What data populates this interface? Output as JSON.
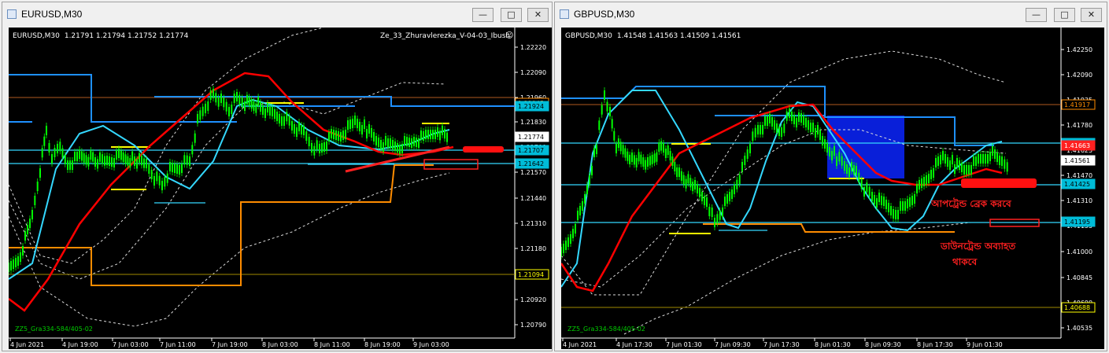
{
  "windows": [
    {
      "title": "EURUSD,M30",
      "chart_title": "EURUSD,M30",
      "ohlc": "1.21791 1.21794 1.21752 1.21774",
      "indicator_name": "Ze_33_Zhuravlerezka_V-04-03_Ibush",
      "watermark": "ZZ5_Gra334-584/405-02",
      "price_ticks": [
        "1.22220",
        "1.22090",
        "1.21960",
        "1.21830",
        "1.21700",
        "1.21570",
        "1.21440",
        "1.21310",
        "1.21180",
        "1.21050",
        "1.20920",
        "1.20790"
      ],
      "time_ticks": [
        "4 Jun 2021",
        "4 Jun 19:00",
        "7 Jun 03:00",
        "7 Jun 11:00",
        "7 Jun 19:00",
        "8 Jun 03:00",
        "8 Jun 11:00",
        "8 Jun 19:00",
        "9 Jun 03:00"
      ],
      "price_labels": [
        {
          "text": "1.21945",
          "style": "orange"
        },
        {
          "text": "1.21924",
          "style": "cyan"
        },
        {
          "text": "1.21774",
          "style": "white"
        },
        {
          "text": "1.21707",
          "style": "cyan"
        },
        {
          "text": "1.21642",
          "style": "cyan"
        },
        {
          "text": "1.21094",
          "style": "yellow"
        }
      ],
      "annotations": []
    },
    {
      "title": "GBPUSD,M30",
      "chart_title": "GBPUSD,M30",
      "ohlc": "1.41548 1.41563 1.41509 1.41561",
      "indicator_name": "",
      "watermark": "ZZ5_Gra334-584/405-02",
      "price_ticks": [
        "1.42250",
        "1.42090",
        "1.41935",
        "1.41780",
        "1.41625",
        "1.41470",
        "1.41310",
        "1.41155",
        "1.41000",
        "1.40845",
        "1.40690",
        "1.40535"
      ],
      "time_ticks": [
        "4 Jun 2021",
        "4 Jun 17:30",
        "7 Jun 01:30",
        "7 Jun 09:30",
        "7 Jun 17:30",
        "8 Jun 01:30",
        "8 Jun 09:30",
        "8 Jun 17:30",
        "9 Jun 01:30"
      ],
      "price_labels": [
        {
          "text": "1.41917",
          "style": "orange"
        },
        {
          "text": "1.41669",
          "style": "cyan"
        },
        {
          "text": "1.41663",
          "style": "red"
        },
        {
          "text": "1.41561",
          "style": "white"
        },
        {
          "text": "1.41425",
          "style": "cyan"
        },
        {
          "text": "1.41195",
          "style": "cyan"
        },
        {
          "text": "1.40688",
          "style": "yellow"
        }
      ],
      "annotations": [
        "আপট্রেন্ড ব্রেক করবে",
        "ডাউনট্রেন্ড অব্যাহত",
        "থাকবে"
      ]
    }
  ],
  "window_buttons": {
    "minimize": "—",
    "restore": "□",
    "close": "✕"
  },
  "colors": {
    "candle": "#00ff00",
    "ma_red": "#ff0000",
    "ma_cyan": "#34d8ff",
    "level_blue": "#1e90ff",
    "level_orange": "#ff8c00",
    "level_yellow": "#ffff00",
    "zone_blue": "#0a24ff",
    "background": "#000000"
  }
}
